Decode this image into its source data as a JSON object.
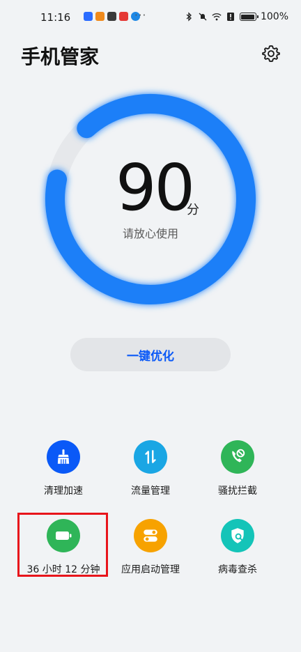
{
  "status_bar": {
    "time": "11:16",
    "more": "···",
    "battery_percent": "100%",
    "app_icons": [
      {
        "name": "app-blue-icon",
        "color": "#2b6cff"
      },
      {
        "name": "app-orange-icon",
        "color": "#f08a1c"
      },
      {
        "name": "app-dark-icon",
        "color": "#3b3b3b"
      },
      {
        "name": "app-red-icon",
        "color": "#e53935"
      },
      {
        "name": "app-globe-icon",
        "color": "#1e88e5"
      }
    ]
  },
  "header": {
    "title": "手机管家",
    "settings_icon": "gear-icon"
  },
  "score": {
    "value": "90",
    "unit": "分",
    "caption": "请放心使用",
    "level": 0.9,
    "ring_color": "#1a7ff8",
    "track_color": "#e6e8eb"
  },
  "optimize_button": {
    "label": "一键优化",
    "color": "#0a59f7"
  },
  "features": [
    {
      "label": "清理加速",
      "icon": "broom-icon",
      "color": "#0a59f7"
    },
    {
      "label": "流量管理",
      "icon": "transfer-arrows-icon",
      "color": "#1aa6e4"
    },
    {
      "label": "骚扰拦截",
      "icon": "phone-block-icon",
      "color": "#2fb558"
    },
    {
      "label": "36 小时 12 分钟",
      "icon": "battery-icon",
      "color": "#2fb558"
    },
    {
      "label": "应用启动管理",
      "icon": "toggle-switches-icon",
      "color": "#f7a200"
    },
    {
      "label": "病毒查杀",
      "icon": "shield-search-icon",
      "color": "#14c4b8"
    }
  ],
  "highlight": {
    "target": "36 小时 12 分钟",
    "color": "#e8141b"
  }
}
